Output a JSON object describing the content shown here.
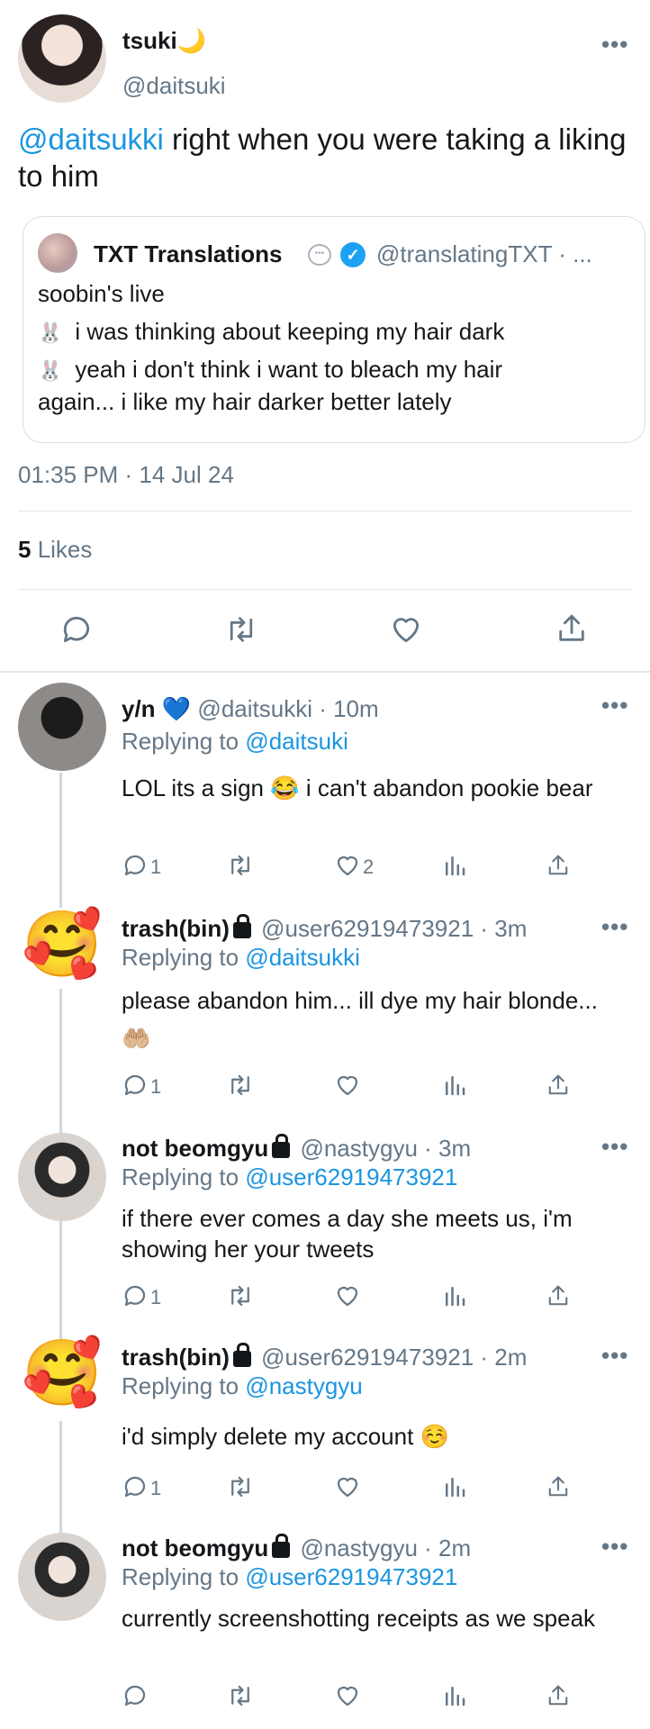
{
  "main_tweet": {
    "display_name": "tsuki🌙",
    "handle": "@daitsuki",
    "mention": "@daitsukki",
    "text": " right when you were taking a liking to him",
    "quote": {
      "display_name": "TXT Translations",
      "handle": "@translatingTXT · ...",
      "line1": "soobin's live",
      "line2": "i was thinking about keeping my hair dark",
      "line3a": "yeah i don't think i want to bleach my hair",
      "line3b": "again... i like my hair darker better lately"
    },
    "timestamp": "01:35 PM · 14 Jul 24",
    "likes_count": "5",
    "likes_label": " Likes",
    "more_label": "•••"
  },
  "replies": [
    {
      "name": "y/n",
      "handle": "@daitsukki · 10m",
      "replying_prefix": "Replying to ",
      "replying_to": "@daitsuki",
      "text": "LOL its a sign 😂  i can't abandon pookie bear",
      "reply_count": "1",
      "like_count": "2"
    },
    {
      "name": "trash(bin)",
      "handle": "@user62919473921 · 3m",
      "replying_prefix": "Replying to ",
      "replying_to": "@daitsukki",
      "text": "please abandon him... ill dye my hair blonde... 🤲🏼",
      "reply_count": "1"
    },
    {
      "name": "not beomgyu",
      "handle": "@nastygyu · 3m",
      "replying_prefix": "Replying to ",
      "replying_to": "@user62919473921",
      "text": "if there ever comes a day she meets us, i'm showing her your tweets",
      "reply_count": "1"
    },
    {
      "name": "trash(bin)",
      "handle": "@user62919473921 · 2m",
      "replying_prefix": "Replying to ",
      "replying_to": "@nastygyu",
      "text": "i'd simply delete my account ☺️",
      "reply_count": "1"
    },
    {
      "name": "not beomgyu",
      "handle": "@nastygyu · 2m",
      "replying_prefix": "Replying to ",
      "replying_to": "@user62919473921",
      "text": "currently screenshotting receipts as we speak"
    }
  ],
  "icons": {
    "reply": "reply-icon",
    "retweet": "retweet-icon",
    "like": "heart-icon",
    "analytics": "analytics-icon",
    "share": "share-icon",
    "verified": "verified-badge-icon",
    "lock": "lock-icon"
  },
  "colors": {
    "accent": "#1b95e0",
    "secondary_text": "#657786",
    "divider": "#e1e8ed"
  }
}
